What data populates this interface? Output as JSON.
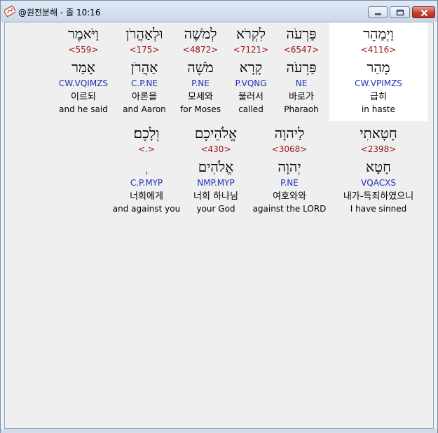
{
  "window": {
    "title": "@원전분해 - 줄 10:16"
  },
  "icons": {
    "app": "bible-app-icon",
    "minimize": "minimize-icon",
    "maximize": "maximize-icon",
    "close": "close-icon"
  },
  "colors": {
    "strong": "#9b1111",
    "morph": "#1c2fb5",
    "selected": "#ffffff"
  },
  "row1": [
    {
      "hebrew": "וַיְמַהֵר",
      "strong": "<4116>",
      "lemma": "מָהַר",
      "morph": "CW.VPIMZS",
      "korean": "급히",
      "english": "in haste"
    },
    {
      "hebrew": "פַּרְעֹה",
      "strong": "<6547>",
      "lemma": "פַּרְעֹה",
      "morph": "NE",
      "korean": "바로가",
      "english": "Pharaoh"
    },
    {
      "hebrew": "לִקְרֹא",
      "strong": "<7121>",
      "lemma": "קָרָא",
      "morph": "P.VQNG",
      "korean": "불러서",
      "english": "called"
    },
    {
      "hebrew": "לְמֹשֶׁה",
      "strong": "<4872>",
      "lemma": "מֹשֶׁה",
      "morph": "P.NE",
      "korean": "모세와",
      "english": "for Moses"
    },
    {
      "hebrew": "וּלְאַהֲרֹן",
      "strong": "<175>",
      "lemma": "אַהֲרֹן",
      "morph": "C.P.NE",
      "korean": "아론을",
      "english": "and Aaron"
    },
    {
      "hebrew": "וַיֹּאמֶר",
      "strong": "<559>",
      "lemma": "אָמַר",
      "morph": "CW.VQIMZS",
      "korean": "이르되",
      "english": "and he said"
    }
  ],
  "row2": [
    {
      "hebrew": "חָטָאתִי",
      "strong": "<2398>",
      "lemma": "חָטָא",
      "morph": "VQACXS",
      "korean": "내가-득죄하였으니",
      "english": "I have sinned"
    },
    {
      "hebrew": "לַיהוָה",
      "strong": "<3068>",
      "lemma": "יְהוָה",
      "morph": "P.NE",
      "korean": "여호와와",
      "english": "against the LORD"
    },
    {
      "hebrew": "אֱלֹהֵיכֶם",
      "strong": "<430>",
      "lemma": "אֱלֹהִים",
      "morph": "NMP.MYP",
      "korean": "너희 하나님",
      "english": "your God"
    },
    {
      "hebrew": "וְלָכֶם׃",
      "strong": "<.>",
      "lemma": "ְ",
      "morph": "C.P.MYP",
      "korean": "너희에게",
      "english": "and against you"
    }
  ]
}
